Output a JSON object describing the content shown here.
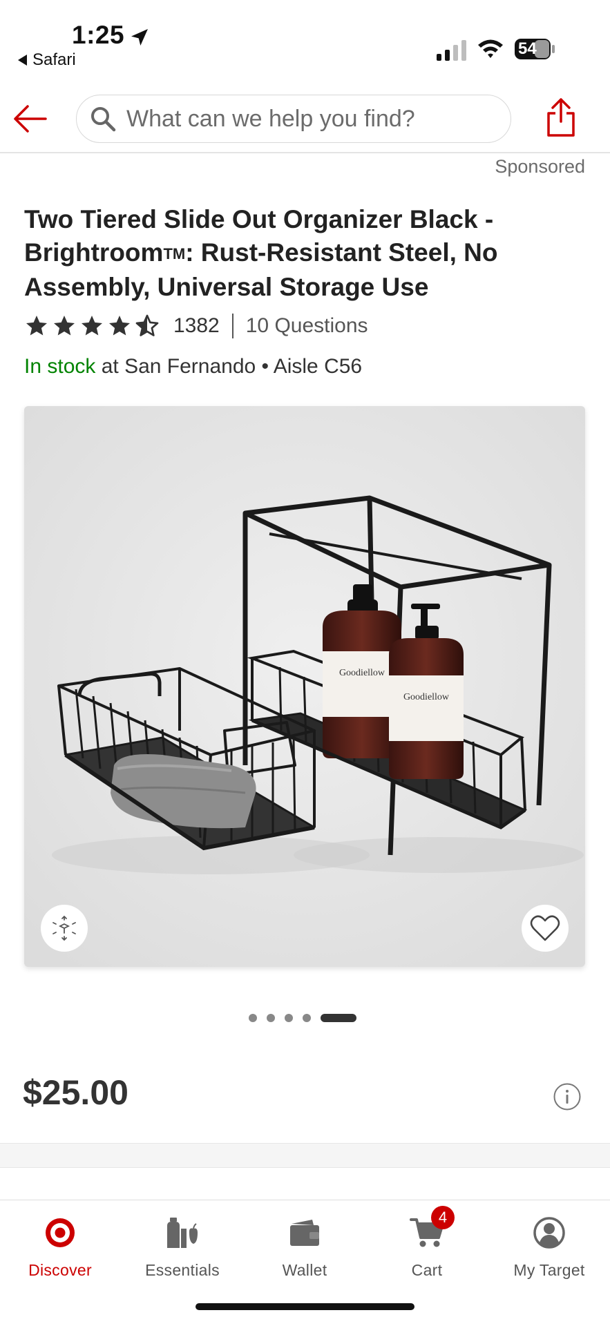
{
  "status_bar": {
    "time": "1:25",
    "back_app": "Safari",
    "battery": "54"
  },
  "header": {
    "search_placeholder": "What can we help you find?"
  },
  "sponsored_label": "Sponsored",
  "product": {
    "title": "Two Tiered Slide Out Organizer Black - Brightroom",
    "title_tm": "TM",
    "title_rest": ": Rust-Resistant Steel, No Assembly, Universal Storage Use",
    "rating": 4.5,
    "rating_count": "1382",
    "questions": "10 Questions",
    "stock_status": "In stock",
    "stock_location": " at San Fernando • Aisle C56",
    "price": "$25.00",
    "image_label": "Goodiellow",
    "carousel": {
      "count": 5,
      "active_index": 4
    }
  },
  "colors": {
    "brand_red": "#cc0000",
    "in_stock_green": "#008300"
  },
  "tabbar": {
    "items": [
      {
        "label": "Discover",
        "icon": "target-bullseye-icon",
        "active": true
      },
      {
        "label": "Essentials",
        "icon": "essentials-icon",
        "active": false
      },
      {
        "label": "Wallet",
        "icon": "wallet-icon",
        "active": false
      },
      {
        "label": "Cart",
        "icon": "cart-icon",
        "active": false,
        "badge": "4"
      },
      {
        "label": "My Target",
        "icon": "person-icon",
        "active": false
      }
    ]
  }
}
